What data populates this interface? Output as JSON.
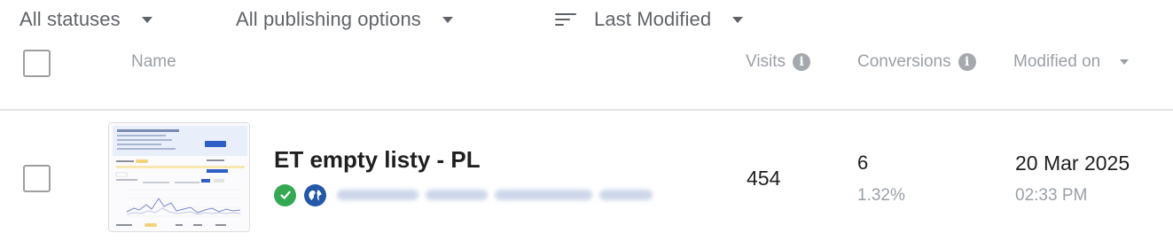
{
  "filters": {
    "status": "All statuses",
    "publishing": "All publishing options",
    "sort": "Last Modified"
  },
  "columns": {
    "name": "Name",
    "visits": "Visits",
    "conversions": "Conversions",
    "modified": "Modified on"
  },
  "icons": {
    "sort": "sort-icon",
    "info": "info-icon",
    "status": "check-circle-icon",
    "publish": "globe-icon",
    "caret": "chevron-down-icon"
  },
  "colors": {
    "status_ok": "#34a853",
    "globe": "#2457a8",
    "muted_text": "#9aa0a6"
  },
  "rows": [
    {
      "name": "ET empty listy - PL",
      "visits": "454",
      "conversions": "6",
      "conversion_rate": "1.32%",
      "modified_date": "20 Mar 2025",
      "modified_time": "02:33 PM"
    }
  ]
}
